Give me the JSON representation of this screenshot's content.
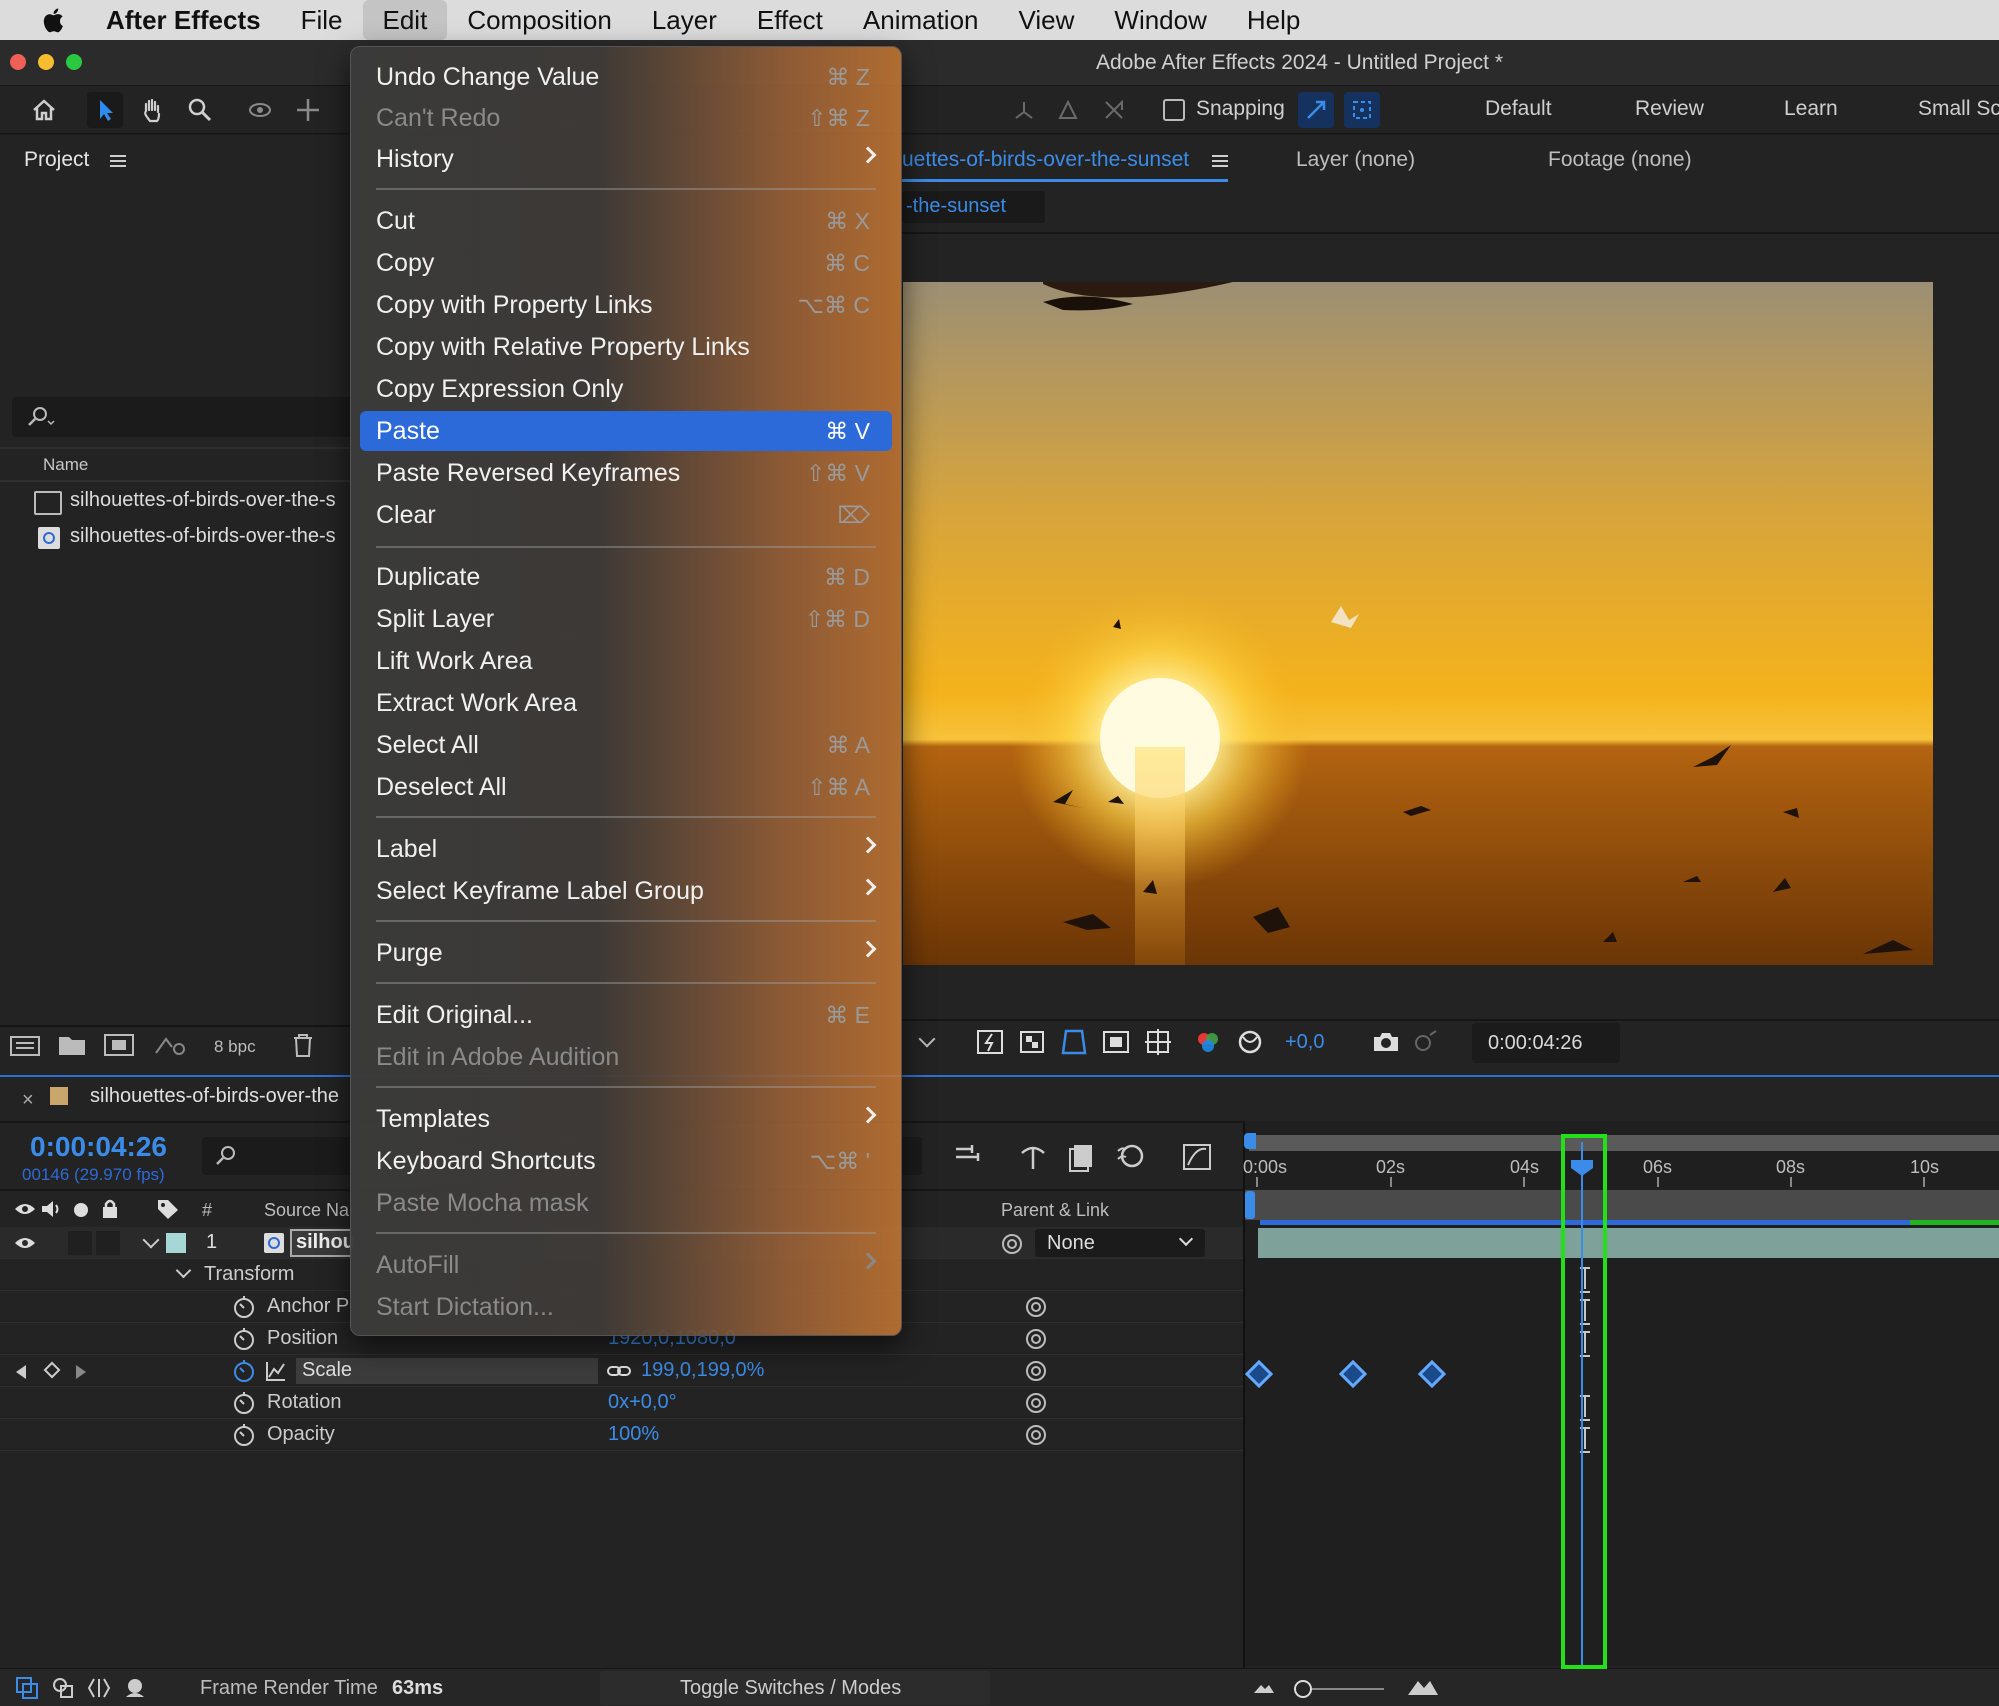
{
  "menubar": {
    "apple": "apple-icon",
    "app": "After Effects",
    "items": [
      "File",
      "Edit",
      "Composition",
      "Layer",
      "Effect",
      "Animation",
      "View",
      "Window",
      "Help"
    ]
  },
  "window": {
    "title": "Adobe After Effects 2024 - Untitled Project *"
  },
  "toolbar": {
    "snapping_label": "Snapping",
    "workspaces": [
      "Default",
      "Review",
      "Learn",
      "Small Sc"
    ]
  },
  "project": {
    "title": "Project",
    "column_name": "Name",
    "items": [
      "silhouettes-of-birds-over-the-s",
      "silhouettes-of-birds-over-the-s"
    ],
    "bpc": "8 bpc"
  },
  "composition": {
    "tab_label": "uettes-of-birds-over-the-sunset",
    "layer_tab": "Layer (none)",
    "footage_tab": "Footage (none)",
    "breadcrumb": "-the-sunset",
    "exposure": "+0,0",
    "timecode": "0:00:04:26"
  },
  "edit_menu": {
    "items": [
      {
        "label": "Undo Change Value",
        "shortcut": "⌘ Z",
        "disabled": false
      },
      {
        "label": "Can't Redo",
        "shortcut": "⇧⌘ Z",
        "disabled": true
      },
      {
        "label": "History",
        "shortcut": "",
        "disabled": false,
        "submenu": true
      },
      {
        "label": "Cut",
        "shortcut": "⌘ X",
        "disabled": false
      },
      {
        "label": "Copy",
        "shortcut": "⌘ C",
        "disabled": false
      },
      {
        "label": "Copy with Property Links",
        "shortcut": "⌥⌘ C",
        "disabled": false
      },
      {
        "label": "Copy with Relative Property Links",
        "shortcut": "",
        "disabled": false
      },
      {
        "label": "Copy Expression Only",
        "shortcut": "",
        "disabled": false
      },
      {
        "label": "Paste",
        "shortcut": "⌘ V",
        "disabled": false,
        "selected": true
      },
      {
        "label": "Paste Reversed Keyframes",
        "shortcut": "⇧⌘ V",
        "disabled": false
      },
      {
        "label": "Clear",
        "shortcut": "⌦",
        "disabled": false
      },
      {
        "label": "Duplicate",
        "shortcut": "⌘ D",
        "disabled": false
      },
      {
        "label": "Split Layer",
        "shortcut": "⇧⌘ D",
        "disabled": false
      },
      {
        "label": "Lift Work Area",
        "shortcut": "",
        "disabled": false
      },
      {
        "label": "Extract Work Area",
        "shortcut": "",
        "disabled": false
      },
      {
        "label": "Select All",
        "shortcut": "⌘ A",
        "disabled": false
      },
      {
        "label": "Deselect All",
        "shortcut": "⇧⌘ A",
        "disabled": false
      },
      {
        "label": "Label",
        "shortcut": "",
        "disabled": false,
        "submenu": true
      },
      {
        "label": "Select Keyframe Label Group",
        "shortcut": "",
        "disabled": false,
        "submenu": true
      },
      {
        "label": "Purge",
        "shortcut": "",
        "disabled": false,
        "submenu": true
      },
      {
        "label": "Edit Original...",
        "shortcut": "⌘ E",
        "disabled": false
      },
      {
        "label": "Edit in Adobe Audition",
        "shortcut": "",
        "disabled": true
      },
      {
        "label": "Templates",
        "shortcut": "",
        "disabled": false,
        "submenu": true
      },
      {
        "label": "Keyboard Shortcuts",
        "shortcut": "⌥⌘ '",
        "disabled": false
      },
      {
        "label": "Paste Mocha mask",
        "shortcut": "",
        "disabled": true
      },
      {
        "label": "AutoFill",
        "shortcut": "",
        "disabled": true,
        "submenu": true
      },
      {
        "label": "Start Dictation...",
        "shortcut": "",
        "disabled": true
      }
    ]
  },
  "timeline": {
    "comp_tab": "silhouettes-of-birds-over-the",
    "timecode": "0:00:04:26",
    "frame_info": "00146 (29.970 fps)",
    "col_number": "#",
    "col_source": "Source Nar",
    "col_parent": "Parent & Link",
    "layer_number": "1",
    "layer_name": "silhou",
    "parent_value": "None",
    "transform_label": "Transform",
    "properties": [
      {
        "name": "Anchor P",
        "value": ""
      },
      {
        "name": "Position",
        "value": "1920,0,1080,0"
      },
      {
        "name": "Scale",
        "value": "199,0,199,0%"
      },
      {
        "name": "Rotation",
        "value": "0x+0,0°"
      },
      {
        "name": "Opacity",
        "value": "100%"
      }
    ],
    "ruler": [
      "0:00s",
      "02s",
      "04s",
      "06s",
      "08s",
      "10s"
    ],
    "render_time_label": "Frame Render Time",
    "render_time_value": "63ms",
    "toggle_label": "Toggle Switches / Modes"
  },
  "colors": {
    "accent_blue": "#2d6ad9",
    "highlight_green": "#22e01a",
    "playhead": "#3b8ce8"
  }
}
